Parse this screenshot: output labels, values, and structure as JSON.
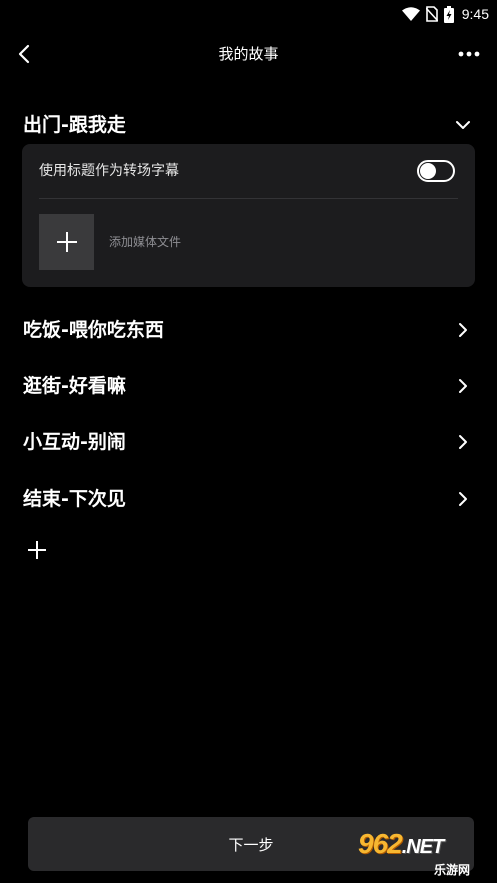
{
  "status_bar": {
    "time": "9:45",
    "icons": [
      "wifi-icon",
      "sim-off-icon",
      "battery-charging-icon"
    ]
  },
  "app_bar": {
    "title": "我的故事",
    "back_icon": "chevron-left-icon",
    "more_icon": "more-horizontal-icon"
  },
  "sections": [
    {
      "title": "出门-跟我走",
      "expanded": true,
      "chevron": "chevron-down-icon"
    },
    {
      "title": "吃饭-喂你吃东西",
      "expanded": false,
      "chevron": "chevron-right-icon"
    },
    {
      "title": "逛街-好看嘛",
      "expanded": false,
      "chevron": "chevron-right-icon"
    },
    {
      "title": "小互动-别闹",
      "expanded": false,
      "chevron": "chevron-right-icon"
    },
    {
      "title": "结束-下次见",
      "expanded": false,
      "chevron": "chevron-right-icon"
    }
  ],
  "expanded_card": {
    "toggle_label": "使用标题作为转场字幕",
    "toggle_on": false,
    "add_media_label": "添加媒体文件"
  },
  "next_button": {
    "label": "下一步"
  },
  "watermark": {
    "logo": "962",
    "logo_suffix": ".NET",
    "sub": "乐游网"
  },
  "colors": {
    "background": "#000000",
    "card": "#1c1c1e",
    "button": "#2a2a2c",
    "text": "#ffffff",
    "muted_text": "#8e8e93"
  }
}
